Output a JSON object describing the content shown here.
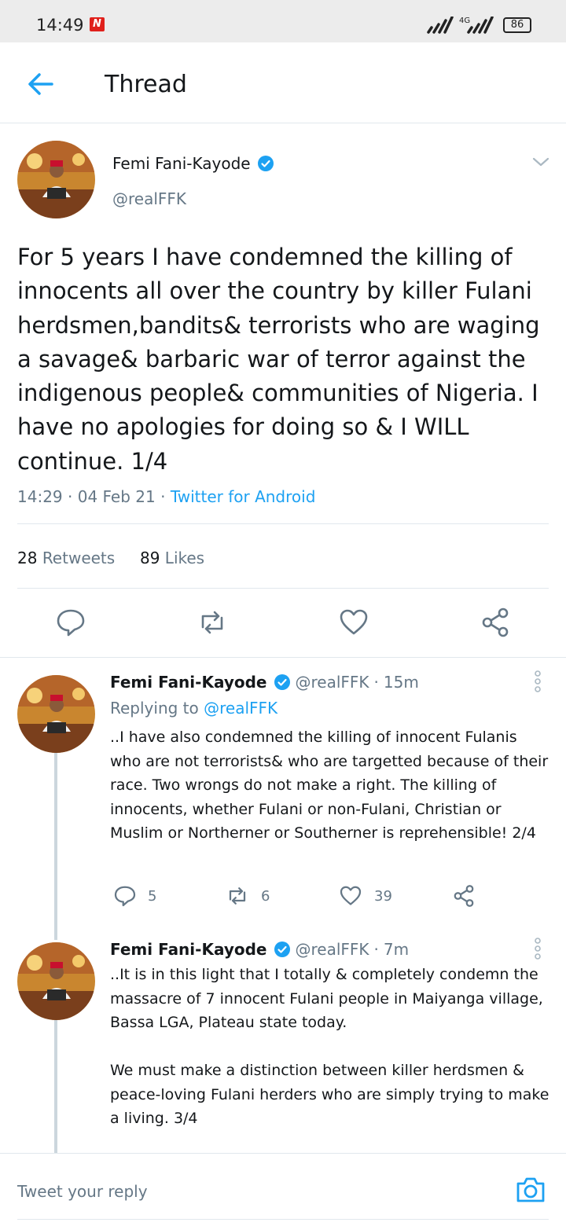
{
  "status_bar": {
    "time": "14:49",
    "app_badge": "N",
    "network": "4G",
    "battery": "86"
  },
  "header": {
    "title": "Thread"
  },
  "main_tweet": {
    "name": "Femi Fani-Kayode",
    "handle": "@realFFK",
    "text": "For 5 years I have condemned the killing of innocents all over the country by killer Fulani herdsmen,bandits& terrorists who are waging a savage& barbaric war of terror against the indigenous people& communities of Nigeria. I have no apologies for doing so & I WILL continue. 1/4",
    "time": "14:29",
    "date": "04 Feb 21",
    "source": "Twitter for Android",
    "retweets_count": "28",
    "retweets_label": "Retweets",
    "likes_count": "89",
    "likes_label": "Likes"
  },
  "replies": [
    {
      "name": "Femi Fani-Kayode",
      "handle": "@realFFK",
      "age": "15m",
      "replying_prefix": "Replying to",
      "replying_to": "@realFFK",
      "text": "..I have also condemned the killing of innocent Fulanis who are not terrorists& who are targetted because of their race. Two wrongs do not make a right. The killing of innocents, whether Fulani or non-Fulani, Christian or Muslim or Northerner or Southerner is reprehensible! 2/4",
      "reply_count": "5",
      "retweet_count": "6",
      "like_count": "39"
    },
    {
      "name": "Femi Fani-Kayode",
      "handle": "@realFFK",
      "age": "7m",
      "text": "..It is in this light that I totally & completely condemn the massacre of 7 innocent Fulani people in Maiyanga village, Bassa LGA, Plateau state today.\n\nWe must make a distinction between killer herdsmen & peace-loving Fulani herders who are simply trying to make a living. 3/4"
    }
  ],
  "reply_bar": {
    "placeholder": "Tweet your reply"
  },
  "colors": {
    "accent": "#1da1f2",
    "secondary_text": "#657786",
    "divider": "#e1e8ed"
  }
}
